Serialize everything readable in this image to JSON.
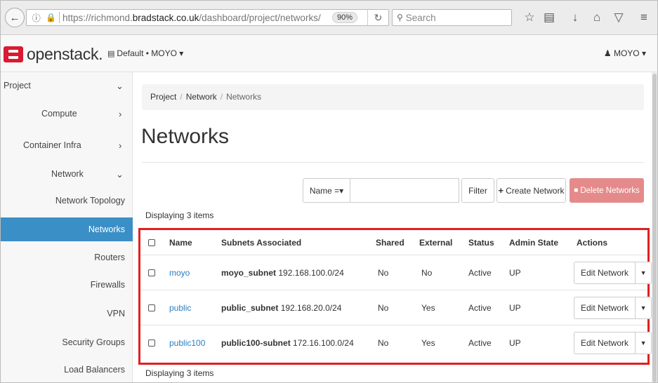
{
  "browser": {
    "url_prefix": "https://richmond.",
    "url_host": "bradstack.co.uk",
    "url_path": "/dashboard/project/networks/",
    "zoom": "90%",
    "search_placeholder": "Search"
  },
  "header": {
    "logo_text": "openstack.",
    "project_selector": "Default • MOYO ▾",
    "user_menu": "MOYO ▾"
  },
  "sidebar": {
    "project": "Project",
    "compute": "Compute",
    "container_infra": "Container Infra",
    "network": "Network",
    "network_topology": "Network Topology",
    "networks": "Networks",
    "routers": "Routers",
    "firewalls": "Firewalls",
    "vpn": "VPN",
    "security_groups": "Security Groups",
    "load_balancers": "Load Balancers"
  },
  "breadcrumb": [
    "Project",
    "Network",
    "Networks"
  ],
  "page_title": "Networks",
  "filter": {
    "field_select": "Name =▾",
    "filter_label": "Filter",
    "create_label": "Create Network",
    "delete_label": "Delete Networks"
  },
  "count_label": "Displaying 3 items",
  "table": {
    "headers": {
      "name": "Name",
      "subnets": "Subnets Associated",
      "shared": "Shared",
      "external": "External",
      "status": "Status",
      "admin_state": "Admin State",
      "actions": "Actions"
    },
    "rows": [
      {
        "name": "moyo",
        "subnet_name": "moyo_subnet",
        "subnet_cidr": "192.168.100.0/24",
        "shared": "No",
        "external": "No",
        "status": "Active",
        "admin_state": "UP",
        "action": "Edit Network"
      },
      {
        "name": "public",
        "subnet_name": "public_subnet",
        "subnet_cidr": "192.168.20.0/24",
        "shared": "No",
        "external": "Yes",
        "status": "Active",
        "admin_state": "UP",
        "action": "Edit Network"
      },
      {
        "name": "public100",
        "subnet_name": "public100-subnet",
        "subnet_cidr": "172.16.100.0/24",
        "shared": "No",
        "external": "Yes",
        "status": "Active",
        "admin_state": "UP",
        "action": "Edit Network"
      }
    ]
  },
  "colors": {
    "accent_active": "#3a8fc7",
    "brand_red": "#da1a32",
    "highlight_border": "#e02020",
    "delete_disabled": "#e58a8a",
    "link": "#2a7ec0"
  }
}
